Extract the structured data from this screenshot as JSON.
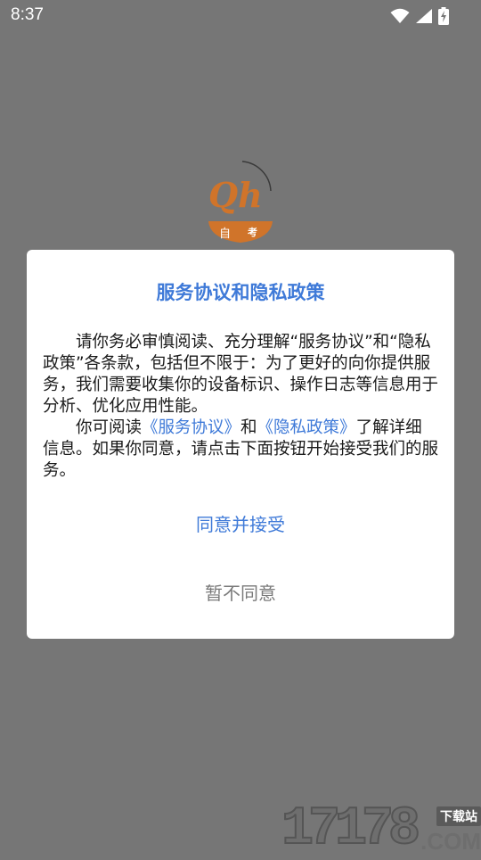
{
  "status_bar": {
    "time": "8:37",
    "icons": [
      "wifi-icon",
      "signal-icon",
      "battery-charging-icon"
    ]
  },
  "logo": {
    "letters": "Qh",
    "char_left": "自",
    "char_right": "考",
    "colors": {
      "orange": "#d0742a",
      "ring": "#3a3a3a"
    }
  },
  "dialog": {
    "title": "服务协议和隐私政策",
    "para1": "请你务必审慎阅读、充分理解“服务协议”和“隐私政策”各条款，包括但不限于：为了更好的向你提供服务，我们需要收集你的设备标识、操作日志等信息用于分析、优化应用性能。",
    "para2_prefix": "你可阅读",
    "link_service": "《服务协议》",
    "para2_and": "和",
    "link_privacy": "《隐私政策》",
    "para2_suffix": "了解详细信息。如果你同意，请点击下面按钮开始接受我们的服务。",
    "accept_label": "同意并接受",
    "decline_label": "暂不同意"
  },
  "watermark": {
    "number": "17178",
    "tag": "下载站",
    "domain": ".COM"
  },
  "colors": {
    "accent": "#3f7ad8",
    "overlay": "#767676",
    "decline": "#7a7a7a"
  }
}
